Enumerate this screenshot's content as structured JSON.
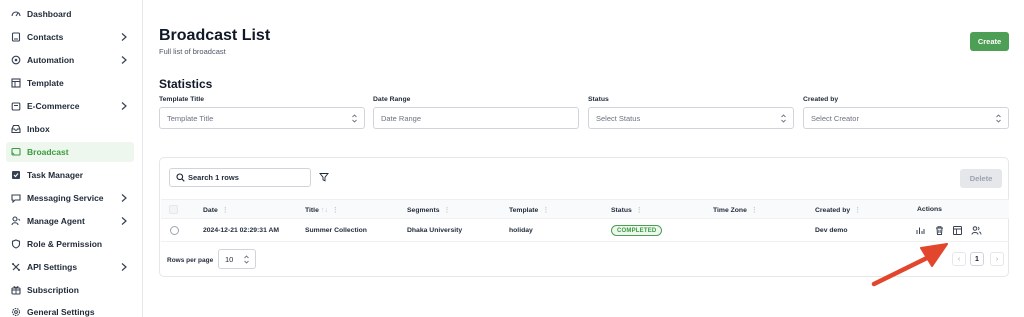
{
  "sidebar": {
    "items": [
      {
        "label": "Dashboard",
        "icon": "dashboard-icon",
        "chevron": false,
        "active": false
      },
      {
        "label": "Contacts",
        "icon": "contacts-icon",
        "chevron": true,
        "active": false
      },
      {
        "label": "Automation",
        "icon": "automation-icon",
        "chevron": true,
        "active": false
      },
      {
        "label": "Template",
        "icon": "template-icon",
        "chevron": false,
        "active": false
      },
      {
        "label": "E-Commerce",
        "icon": "ecommerce-icon",
        "chevron": true,
        "active": false
      },
      {
        "label": "Inbox",
        "icon": "inbox-icon",
        "chevron": false,
        "active": false
      },
      {
        "label": "Broadcast",
        "icon": "broadcast-icon",
        "chevron": false,
        "active": true
      },
      {
        "label": "Task Manager",
        "icon": "task-icon",
        "chevron": false,
        "active": false
      },
      {
        "label": "Messaging Service",
        "icon": "messaging-icon",
        "chevron": true,
        "active": false
      },
      {
        "label": "Manage Agent",
        "icon": "agent-icon",
        "chevron": true,
        "active": false
      },
      {
        "label": "Role & Permission",
        "icon": "shield-icon",
        "chevron": false,
        "active": false
      },
      {
        "label": "API Settings",
        "icon": "api-icon",
        "chevron": true,
        "active": false
      },
      {
        "label": "Subscription",
        "icon": "subscription-icon",
        "chevron": false,
        "active": false
      },
      {
        "label": "General Settings",
        "icon": "gear-icon",
        "chevron": false,
        "active": false
      }
    ]
  },
  "header": {
    "title": "Broadcast List",
    "subtitle": "Full list of broadcast",
    "create_label": "Create"
  },
  "statistics": {
    "title": "Statistics",
    "filters": [
      {
        "label": "Template Title",
        "placeholder": "Template Title",
        "type": "select"
      },
      {
        "label": "Date Range",
        "placeholder": "Date Range",
        "type": "input"
      },
      {
        "label": "Status",
        "placeholder": "Select Status",
        "type": "select"
      },
      {
        "label": "Created by",
        "placeholder": "Select Creator",
        "type": "select"
      }
    ]
  },
  "table": {
    "search_placeholder": "Search 1 rows",
    "delete_label": "Delete",
    "columns": [
      "Date",
      "Title",
      "Segments",
      "Template",
      "Status",
      "Time Zone",
      "Created by",
      "Actions"
    ],
    "sort_indicator": "↑↓",
    "rows": [
      {
        "date": "2024-12-21 02:29:31 AM",
        "title": "Summer Collection",
        "segments": "Dhaka University",
        "template": "holiday",
        "status": "COMPLETED",
        "time_zone": "",
        "created_by": "Dev demo"
      }
    ],
    "actions": [
      "stats-icon",
      "trash-icon",
      "view-icon",
      "users-icon"
    ],
    "rows_per_page_label": "Rows per page",
    "rows_per_page_value": "10",
    "current_page": "1"
  },
  "colors": {
    "accent": "#4c9f54",
    "annotation_arrow": "#e2462c"
  }
}
